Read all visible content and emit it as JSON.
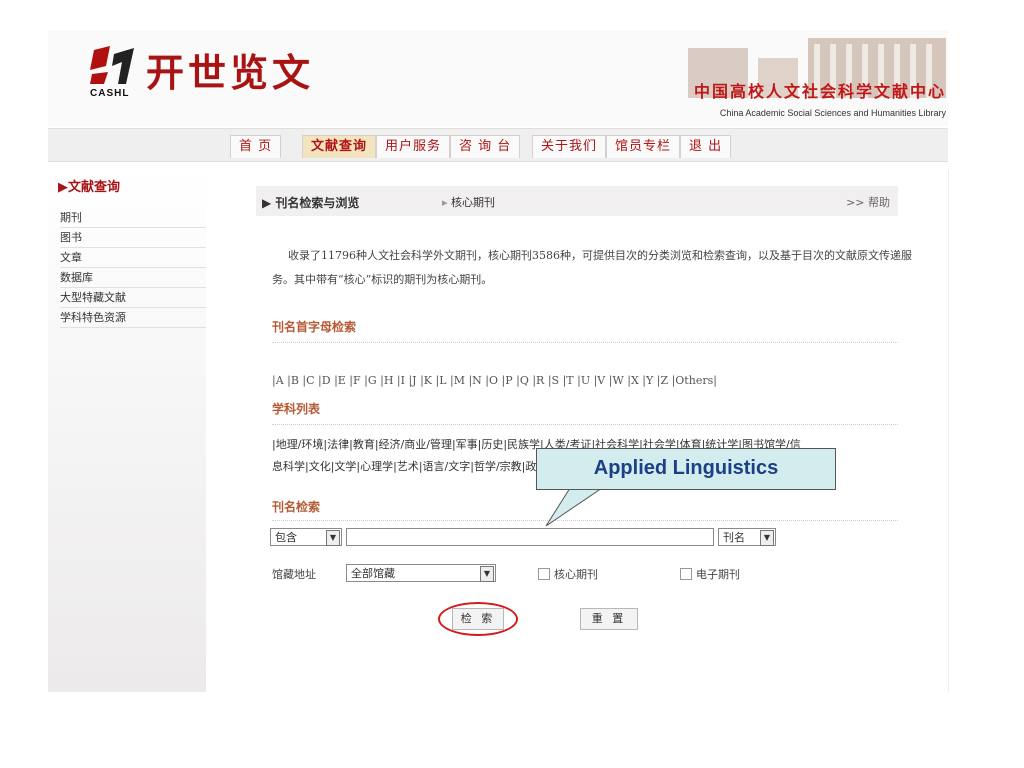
{
  "header": {
    "logo_short": "CASHL",
    "title": "开世览文",
    "org_cn": "中国高校人文社会科学文献中心",
    "org_en": "China Academic Social Sciences and Humanities Library"
  },
  "nav": [
    "首 页",
    "文献查询",
    "用户服务",
    "咨 询 台",
    "关于我们",
    "馆员专栏",
    "退 出"
  ],
  "sidebar": {
    "title": "文献查询",
    "items": [
      "期刊",
      "图书",
      "文章",
      "数据库",
      "大型特藏文献",
      "学科特色资源"
    ]
  },
  "tabs": {
    "current": "刊名检索与浏览",
    "second": "核心期刊",
    "help": ">> 帮助"
  },
  "intro": "收录了11796种人文社会科学外文期刊，核心期刊3586种，可提供目次的分类浏览和检索查询，以及基于目次的文献原文传递服务。其中带有“核心”标识的期刊为核心期刊。",
  "alpha_section": {
    "title": "刊名首字母检索",
    "letters": "|A |B |C |D |E |F |G |H |I |J |K |L |M |N |O |P |Q |R |S |T |U |V |W |X |Y |Z |Others|"
  },
  "subject_section": {
    "title": "学科列表",
    "line1": "|地理/环境|法律|教育|经济/商业/管理|军事|历史|民族学|人类/考证|社会科学|社会学|体育|统计学|图书馆学/信",
    "line2": "息科学|文化|文学|心理学|艺术|语言/文字|哲学/宗教|政治|"
  },
  "search": {
    "title": "刊名检索",
    "match_select": "包含",
    "query_value": "",
    "field_select": "刊名",
    "location_label": "馆藏地址",
    "location_select": "全部馆藏",
    "check_core": "核心期刊",
    "check_electronic": "电子期刊",
    "submit_label": "检 索",
    "reset_label": "重 置"
  },
  "callout": {
    "text": "Applied Linguistics",
    "fill_color": "#d3ecee",
    "text_color": "#1c3f86"
  },
  "colors": {
    "brand": "#a81414",
    "section": "#b55a34",
    "highlight": "#d41a1a"
  }
}
